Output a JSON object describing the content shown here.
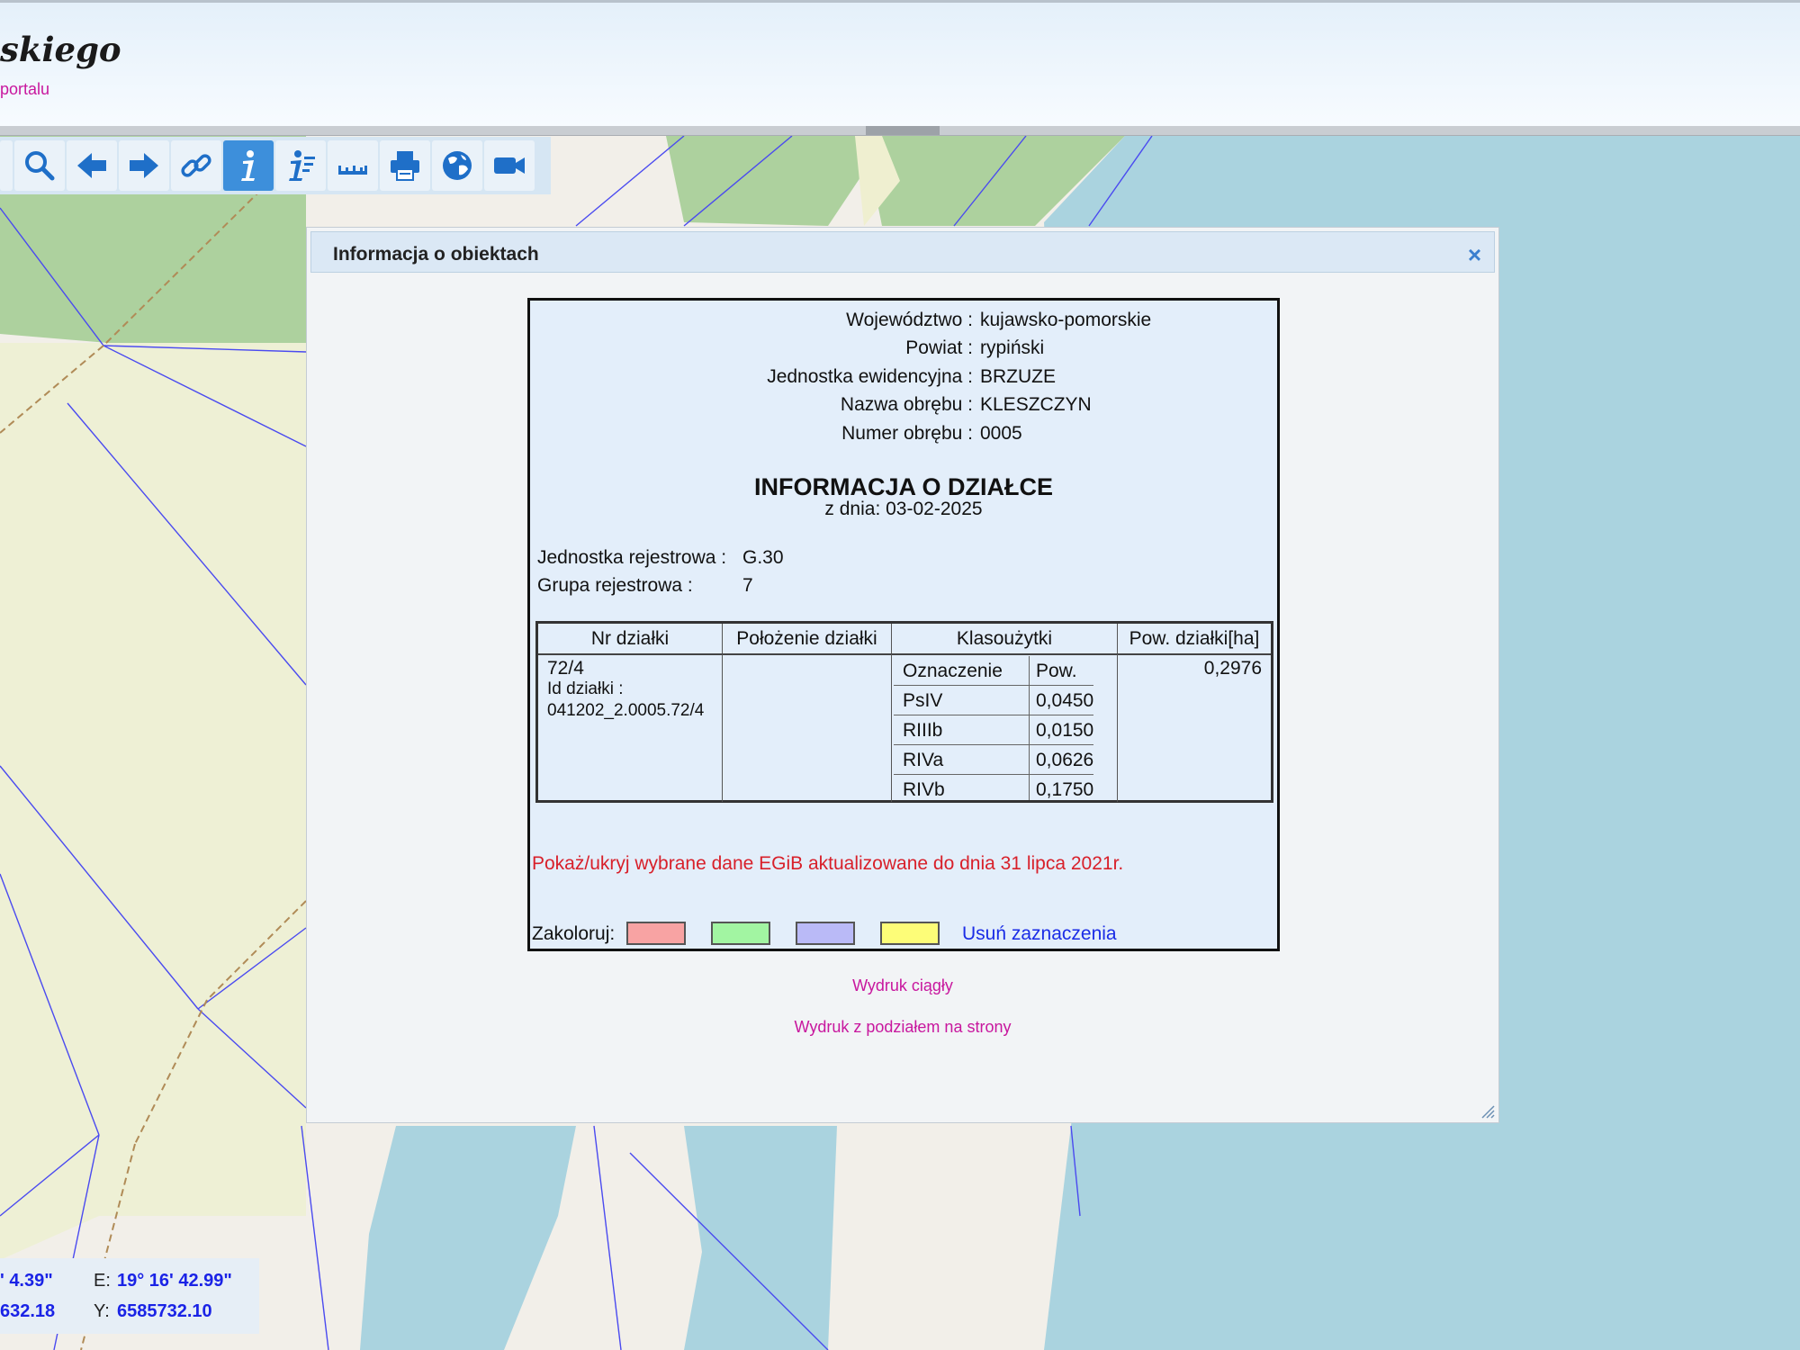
{
  "header": {
    "title": "skiego",
    "subtitle": "portalu"
  },
  "toolbar": {
    "tools": [
      {
        "name": "zoom-icon"
      },
      {
        "name": "back-arrow-icon"
      },
      {
        "name": "forward-arrow-icon"
      },
      {
        "name": "link-icon"
      },
      {
        "name": "info-icon",
        "active": true
      },
      {
        "name": "info-list-icon"
      },
      {
        "name": "ruler-icon"
      },
      {
        "name": "print-icon"
      },
      {
        "name": "globe-icon"
      },
      {
        "name": "video-camera-icon"
      }
    ]
  },
  "coords": {
    "lat_value": "' 4.39\"",
    "e_label": "E:",
    "e_value": "19° 16' 42.99\"",
    "x_value": "632.18",
    "y_label": "Y:",
    "y_value": "6585732.10"
  },
  "dialog": {
    "title": "Informacja o obiektach",
    "close_label": "×"
  },
  "parcel_info": {
    "meta": [
      {
        "label": "Województwo :",
        "value": "kujawsko-pomorskie"
      },
      {
        "label": "Powiat :",
        "value": "rypiński"
      },
      {
        "label": "Jednostka ewidencyjna :",
        "value": "BRZUZE"
      },
      {
        "label": "Nazwa obrębu :",
        "value": "KLESZCZYN"
      },
      {
        "label": "Numer obrębu :",
        "value": "0005"
      }
    ],
    "heading": "INFORMACJA O DZIAŁCE",
    "date": "z dnia: 03-02-2025",
    "registry_unit_label": "Jednostka rejestrowa :",
    "registry_unit_value": "G.30",
    "registry_group_label": "Grupa rejestrowa :",
    "registry_group_value": "7",
    "table": {
      "headers": [
        "Nr działki",
        "Położenie działki",
        "Klasoużytki",
        "Pow. działki[ha]"
      ],
      "plot_number": "72/4",
      "plot_id_label": "Id działki :",
      "plot_id": "041202_2.0005.72/4",
      "location": "",
      "class_headers": [
        "Oznaczenie",
        "Pow."
      ],
      "classes": [
        {
          "code": "PsIV",
          "area": "0,0450"
        },
        {
          "code": "RIIIb",
          "area": "0,0150"
        },
        {
          "code": "RIVa",
          "area": "0,0626"
        },
        {
          "code": "RIVb",
          "area": "0,1750"
        }
      ],
      "total_area": "0,2976"
    },
    "toggle_link": "Pokaż/ukryj wybrane dane EGiB aktualizowane do dnia 31 lipca 2021r.",
    "colorize_label": "Zakoloruj:",
    "swatches": [
      "#f8a3a3",
      "#a2f5a2",
      "#babaf7",
      "#fdfd78"
    ],
    "clear_link": "Usuń zaznaczenia"
  },
  "print": {
    "continuous": "Wydruk ciągły",
    "paged": "Wydruk z podziałem na strony"
  }
}
